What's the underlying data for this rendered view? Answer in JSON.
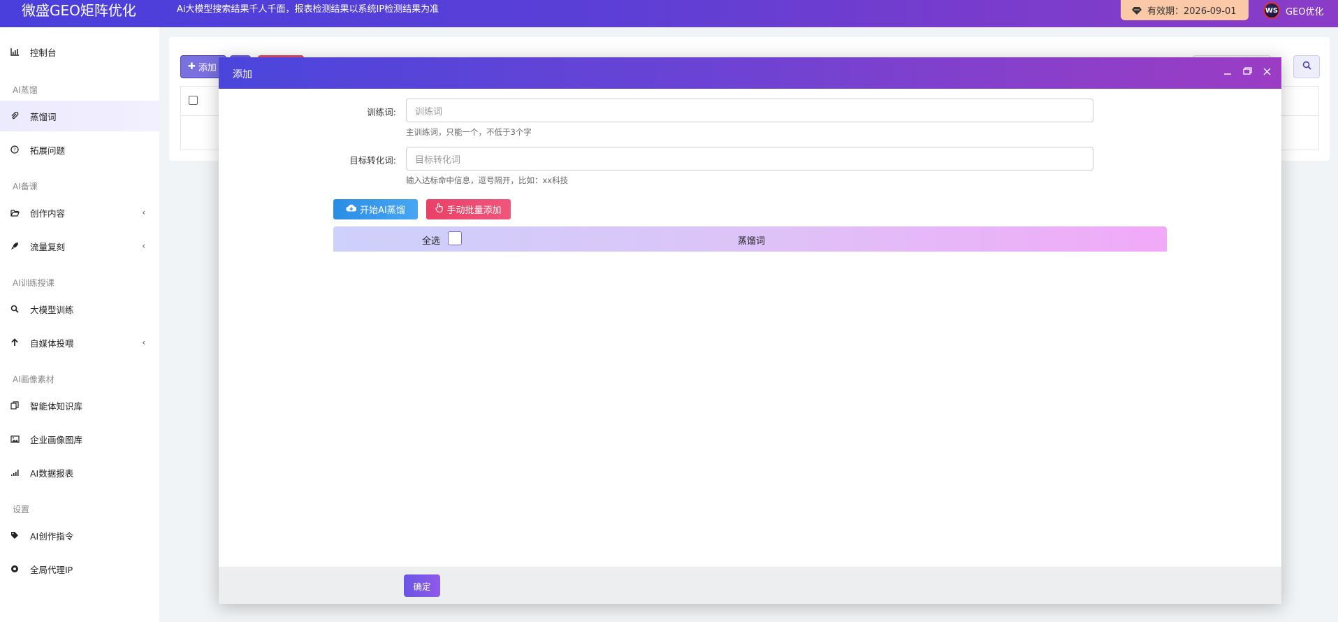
{
  "header": {
    "brand": "微盛GEO矩阵优化",
    "notice": "Ai大模型搜索结果千人千面，报表检测结果以系统IP检测结果为准",
    "expiry_label": "有效期：2026-09-01",
    "avatar_text": "WS",
    "user_name": "GEO优化"
  },
  "sidebar": {
    "dashboard": "控制台",
    "groups": {
      "distill": "AI蒸馏",
      "prep": "AI备课",
      "train": "AI训练授课",
      "image": "AI画像素材",
      "settings": "设置"
    },
    "items": {
      "distill_words": "蒸馏词",
      "expand_questions": "拓展问题",
      "create_content": "创作内容",
      "traffic_copy": "流量复刻",
      "llm_train": "大模型训练",
      "media_feed": "自媒体投喂",
      "agent_kb": "智能体知识库",
      "enterprise_gallery": "企业画像图库",
      "ai_report": "AI数据报表",
      "ai_command": "AI创作指令",
      "global_proxy": "全局代理IP"
    },
    "chevron": "‹"
  },
  "background": {
    "add_button": "添加"
  },
  "modal": {
    "title": "添加",
    "fields": {
      "train_word_label": "训练词:",
      "train_word_placeholder": "训练词",
      "train_word_help": "主训练词，只能一个，不低于3个字",
      "target_word_label": "目标转化词:",
      "target_word_placeholder": "目标转化词",
      "target_word_help": "输入达标命中信息，逗号隔开，比如：xx科技"
    },
    "buttons": {
      "start_ai": "开始AI蒸馏",
      "manual_add": "手动批量添加",
      "confirm": "确定"
    },
    "table": {
      "select_all": "全选",
      "column": "蒸馏词"
    }
  },
  "colors": {
    "header_gradient_start": "#4a3fdc",
    "header_gradient_end": "#8a3cc8",
    "accent": "#6a55e6",
    "danger": "#e94067",
    "info": "#2a8de6"
  }
}
